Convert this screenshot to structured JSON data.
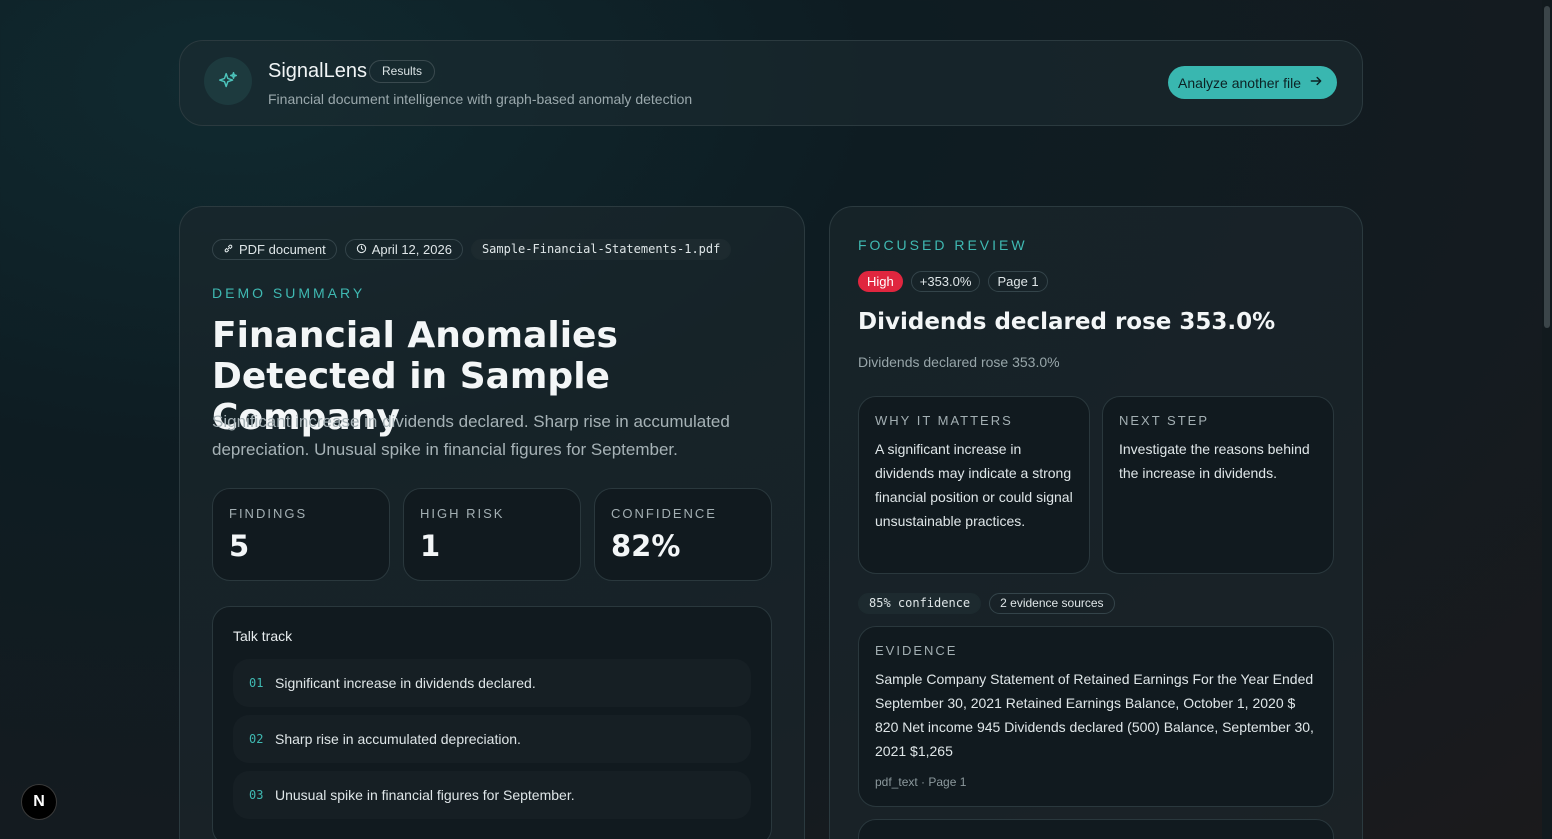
{
  "header": {
    "brand": "SignalLens",
    "badge": "Results",
    "tagline": "Financial document intelligence with graph-based anomaly detection",
    "action_label": "Analyze another file"
  },
  "summary_card": {
    "chips": {
      "doc_type": "PDF document",
      "date": "April 12, 2026",
      "filename": "Sample-Financial-Statements-1.pdf"
    },
    "eyebrow": "DEMO SUMMARY",
    "title": "Financial Anomalies Detected in Sample Company",
    "summary": "Significant increase in dividends declared. Sharp rise in accumulated depreciation. Unusual spike in financial figures for September.",
    "stats": [
      {
        "label": "FINDINGS",
        "value": "5"
      },
      {
        "label": "HIGH RISK",
        "value": "1"
      },
      {
        "label": "CONFIDENCE",
        "value": "82%"
      }
    ],
    "talk_track": {
      "title": "Talk track",
      "items": [
        {
          "num": "01",
          "text": "Significant increase in dividends declared."
        },
        {
          "num": "02",
          "text": "Sharp rise in accumulated depreciation."
        },
        {
          "num": "03",
          "text": "Unusual spike in financial figures for September."
        }
      ]
    }
  },
  "focused_review": {
    "eyebrow": "FOCUSED REVIEW",
    "tags": {
      "severity": "High",
      "change": "+353.0%",
      "page": "Page 1"
    },
    "title": "Dividends declared rose 353.0%",
    "subtitle": "Dividends declared rose 353.0%",
    "why": {
      "label": "WHY IT MATTERS",
      "text": "A significant increase in dividends may indicate a strong financial position or could signal unsustainable practices."
    },
    "next": {
      "label": "NEXT STEP",
      "text": "Investigate the reasons behind the increase in dividends."
    },
    "meta": {
      "confidence": "85% confidence",
      "sources": "2 evidence sources"
    },
    "evidence": {
      "label": "EVIDENCE",
      "text": "Sample Company Statement of Retained Earnings For the Year Ended September 30, 2021 Retained Earnings Balance, October 1, 2020 $ 820 Net income 945 Dividends declared (500) Balance, September 30, 2021 $1,265",
      "source": "pdf_text · Page 1"
    }
  },
  "colors": {
    "accent": "#3fb9b2",
    "danger": "#e0263f",
    "button": "#39b7b0"
  },
  "icons": {
    "logo": "sparkle-icon",
    "doc": "link-icon",
    "date": "clock-icon",
    "action": "arrow-right-icon",
    "framework": "next-logo-icon"
  },
  "framework_badge": "N"
}
